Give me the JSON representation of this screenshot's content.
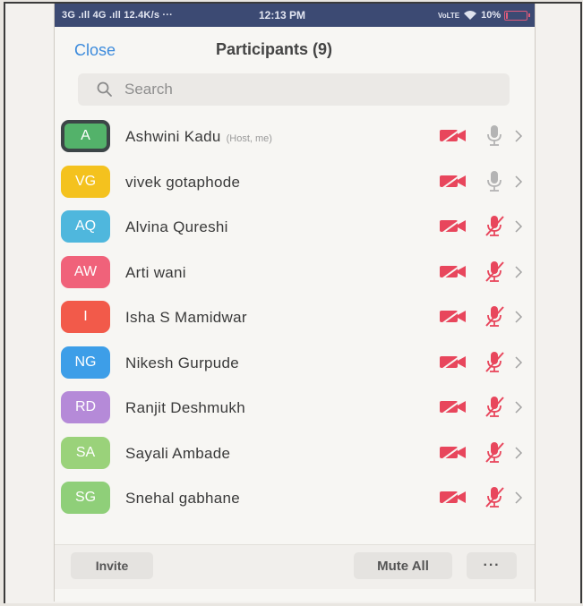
{
  "status_bar": {
    "signal": "3G .ıll 4G .ıll 12.4K/s ···",
    "time": "12:13 PM",
    "network": "VoLTE",
    "battery_percent": "10%",
    "battery_level": 0.1,
    "battery_color": "#e05a7a"
  },
  "header": {
    "close_label": "Close",
    "title": "Participants (9)"
  },
  "search": {
    "placeholder": "Search"
  },
  "participants": [
    {
      "initials": "A",
      "name": "Ashwini Kadu",
      "tag": "(Host, me)",
      "color": "#53b26a",
      "host": true,
      "mic_muted": false
    },
    {
      "initials": "VG",
      "name": "vivek gotaphode",
      "tag": "",
      "color": "#f4c21e",
      "host": false,
      "mic_muted": false
    },
    {
      "initials": "AQ",
      "name": "Alvina Qureshi",
      "tag": "",
      "color": "#4fb7dd",
      "host": false,
      "mic_muted": true
    },
    {
      "initials": "AW",
      "name": "Arti wani",
      "tag": "",
      "color": "#f0627a",
      "host": false,
      "mic_muted": true
    },
    {
      "initials": "I",
      "name": "Isha S Mamidwar",
      "tag": "",
      "color": "#f25a4a",
      "host": false,
      "mic_muted": true
    },
    {
      "initials": "NG",
      "name": "Nikesh Gurpude",
      "tag": "",
      "color": "#3d9ee8",
      "host": false,
      "mic_muted": true
    },
    {
      "initials": "RD",
      "name": "Ranjit Deshmukh",
      "tag": "",
      "color": "#b58ad8",
      "host": false,
      "mic_muted": true
    },
    {
      "initials": "SA",
      "name": "Sayali Ambade",
      "tag": "",
      "color": "#9ad27a",
      "host": false,
      "mic_muted": true
    },
    {
      "initials": "SG",
      "name": "Snehal gabhane",
      "tag": "",
      "color": "#8fcf79",
      "host": false,
      "mic_muted": true
    }
  ],
  "icons": {
    "camera": "video-off-icon",
    "mic": "microphone-icon",
    "chevron": "chevron-right-icon",
    "search": "search-icon"
  },
  "colors": {
    "muted_red": "#e8465c",
    "mic_gray": "#b4b4b4",
    "accent": "#3d8bdc"
  },
  "footer": {
    "invite_label": "Invite",
    "mute_all_label": "Mute All",
    "more_label": "···"
  }
}
